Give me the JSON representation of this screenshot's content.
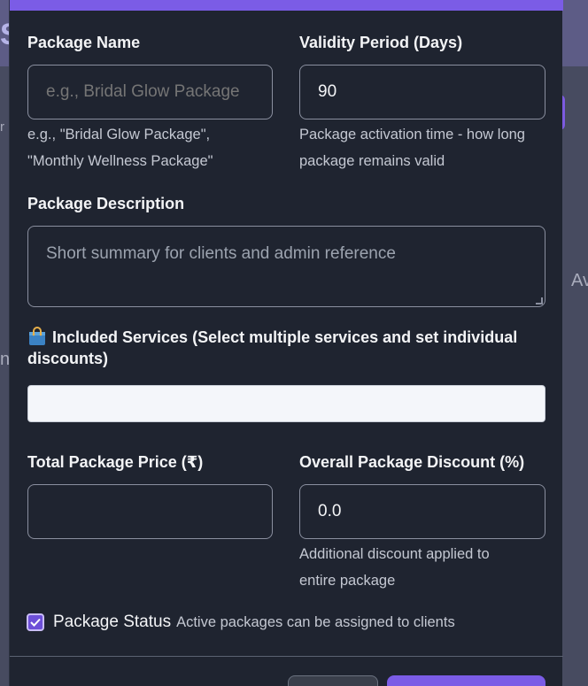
{
  "background": {
    "title_fragment": "S",
    "frag_left_1": "r",
    "frag_left_2": "n",
    "frag_right": "Av"
  },
  "form": {
    "package_name": {
      "label": "Package Name",
      "value": "",
      "placeholder": "e.g., Bridal Glow Package",
      "hint_line1": "e.g., \"Bridal Glow Package\",",
      "hint_line2": "\"Monthly Wellness Package\""
    },
    "validity": {
      "label": "Validity Period (Days)",
      "value": "90",
      "hint_line1": "Package activation time - how long",
      "hint_line2": "package remains valid"
    },
    "description": {
      "label": "Package Description",
      "placeholder": "Short summary for clients and admin reference"
    },
    "services": {
      "label_line1": "Included Services (Select multiple services and set individual",
      "label_line2": "discounts)",
      "icon": "shopping-bag-icon"
    },
    "total_price": {
      "label": "Total Package Price (₹)",
      "value": ""
    },
    "overall_discount": {
      "label": "Overall Package Discount (%)",
      "value": "0.0",
      "hint_line1": "Additional discount applied to",
      "hint_line2": "entire package"
    },
    "status": {
      "label": "Package Status",
      "note": "Active packages can be assigned to clients",
      "checked": true
    }
  },
  "colors": {
    "accent": "#7b5ce6",
    "modal_bg": "#1f2430"
  }
}
